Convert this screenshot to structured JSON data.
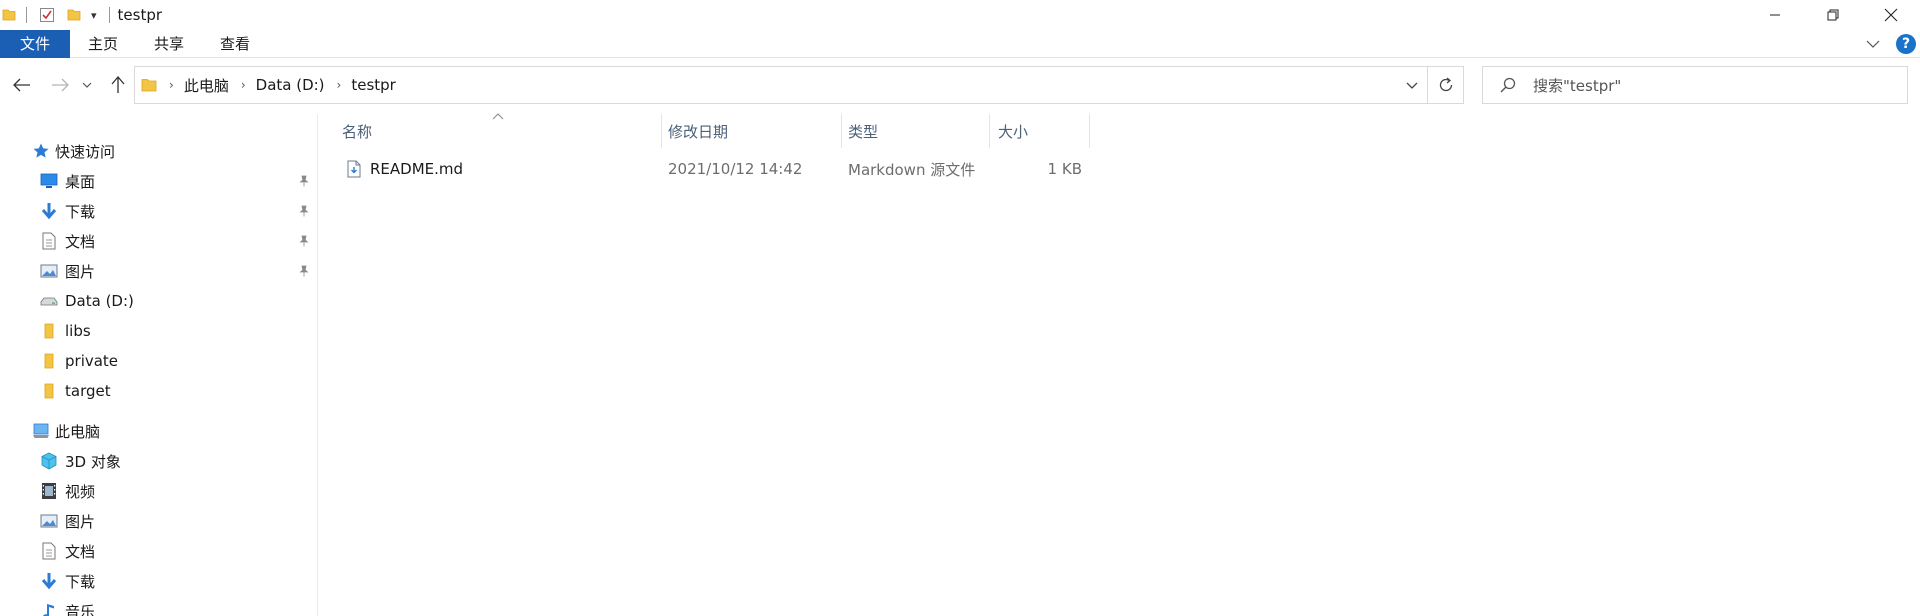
{
  "window": {
    "title": "testpr"
  },
  "ribbon": {
    "file_tab": "文件",
    "tabs": [
      "主页",
      "共享",
      "查看"
    ]
  },
  "address": {
    "crumbs": [
      "此电脑",
      "Data (D:)",
      "testpr"
    ]
  },
  "search": {
    "placeholder": "搜索\"testpr\""
  },
  "nav": {
    "quick_access": "快速访问",
    "quick_items": [
      {
        "label": "桌面",
        "icon": "desktop-icon",
        "pinned": true
      },
      {
        "label": "下载",
        "icon": "download-icon",
        "pinned": true
      },
      {
        "label": "文档",
        "icon": "documents-icon",
        "pinned": true
      },
      {
        "label": "图片",
        "icon": "pictures-icon",
        "pinned": true
      },
      {
        "label": "Data (D:)",
        "icon": "drive-icon",
        "pinned": false
      },
      {
        "label": "libs",
        "icon": "folder-icon",
        "pinned": false
      },
      {
        "label": "private",
        "icon": "folder-icon",
        "pinned": false
      },
      {
        "label": "target",
        "icon": "folder-icon",
        "pinned": false
      }
    ],
    "this_pc": "此电脑",
    "pc_items": [
      {
        "label": "3D 对象",
        "icon": "3d-objects-icon"
      },
      {
        "label": "视频",
        "icon": "videos-icon"
      },
      {
        "label": "图片",
        "icon": "pictures-icon"
      },
      {
        "label": "文档",
        "icon": "documents-icon"
      },
      {
        "label": "下载",
        "icon": "download-icon"
      },
      {
        "label": "音乐",
        "icon": "music-icon"
      }
    ]
  },
  "columns": {
    "name": "名称",
    "modified": "修改日期",
    "type": "类型",
    "size": "大小"
  },
  "files": [
    {
      "name": "README.md",
      "modified": "2021/10/12 14:42",
      "type": "Markdown 源文件",
      "size": "1 KB"
    }
  ],
  "colors": {
    "accent": "#1a5fb4",
    "folder": "#f4c542",
    "header_text": "#4c607a"
  }
}
